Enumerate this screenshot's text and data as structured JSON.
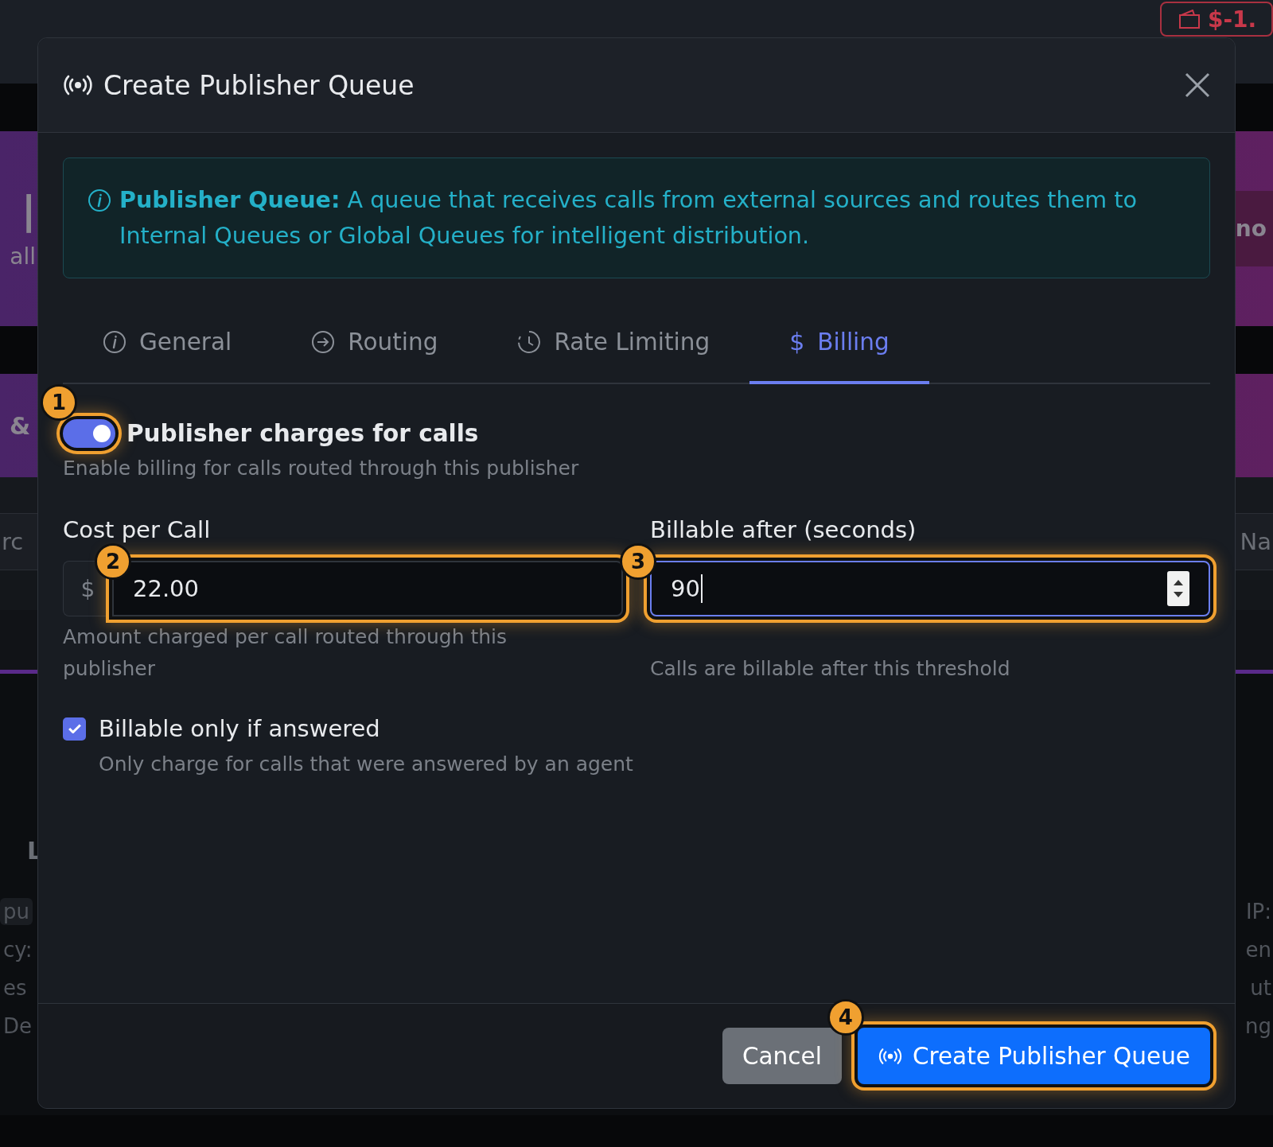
{
  "background": {
    "balance": "$-1.",
    "hero": {
      "left_title": "l",
      "left_sub": "all",
      "right": "no"
    },
    "card": {
      "left": "&"
    },
    "search_row": {
      "left": "rc",
      "right": "Na"
    },
    "section_title": "L",
    "list_rows": [
      {
        "left": "pu",
        "right": "IP:"
      },
      {
        "left": "cy:",
        "right": "en"
      },
      {
        "left": "es",
        "right": "ut"
      },
      {
        "left": "De",
        "right": "ng"
      }
    ]
  },
  "dialog": {
    "title": "Create Publisher Queue",
    "info": "**Publisher Queue:** A queue that receives calls from external sources and routes them to Internal Queues or Global Queues for intelligent distribution.",
    "tabs": [
      {
        "label": "General",
        "selected": false
      },
      {
        "label": "Routing",
        "selected": false
      },
      {
        "label": "Rate Limiting",
        "selected": false
      },
      {
        "label": "Billing",
        "glyph": "$",
        "selected": true
      }
    ],
    "toggle": {
      "label": "Publisher charges for calls",
      "on": true,
      "help": "Enable billing for calls routed through this publisher",
      "marker": "1"
    },
    "cost": {
      "label": "Cost per Call",
      "prefix": "$",
      "value": "22.00",
      "help": "Amount charged per call routed through this publisher",
      "marker": "2",
      "focused": false
    },
    "after": {
      "label": "Billable after (seconds)",
      "value": "90",
      "help": "Calls are billable after this threshold",
      "marker": "3",
      "focused": true
    },
    "answered": {
      "label": "Billable only if answered",
      "checked": true,
      "help": "Only charge for calls that were answered by an agent"
    },
    "buttons": [
      {
        "label": "Cancel",
        "kind": "secondary"
      },
      {
        "label": "Create Publisher Queue",
        "kind": "primary",
        "marker": "4"
      }
    ]
  }
}
